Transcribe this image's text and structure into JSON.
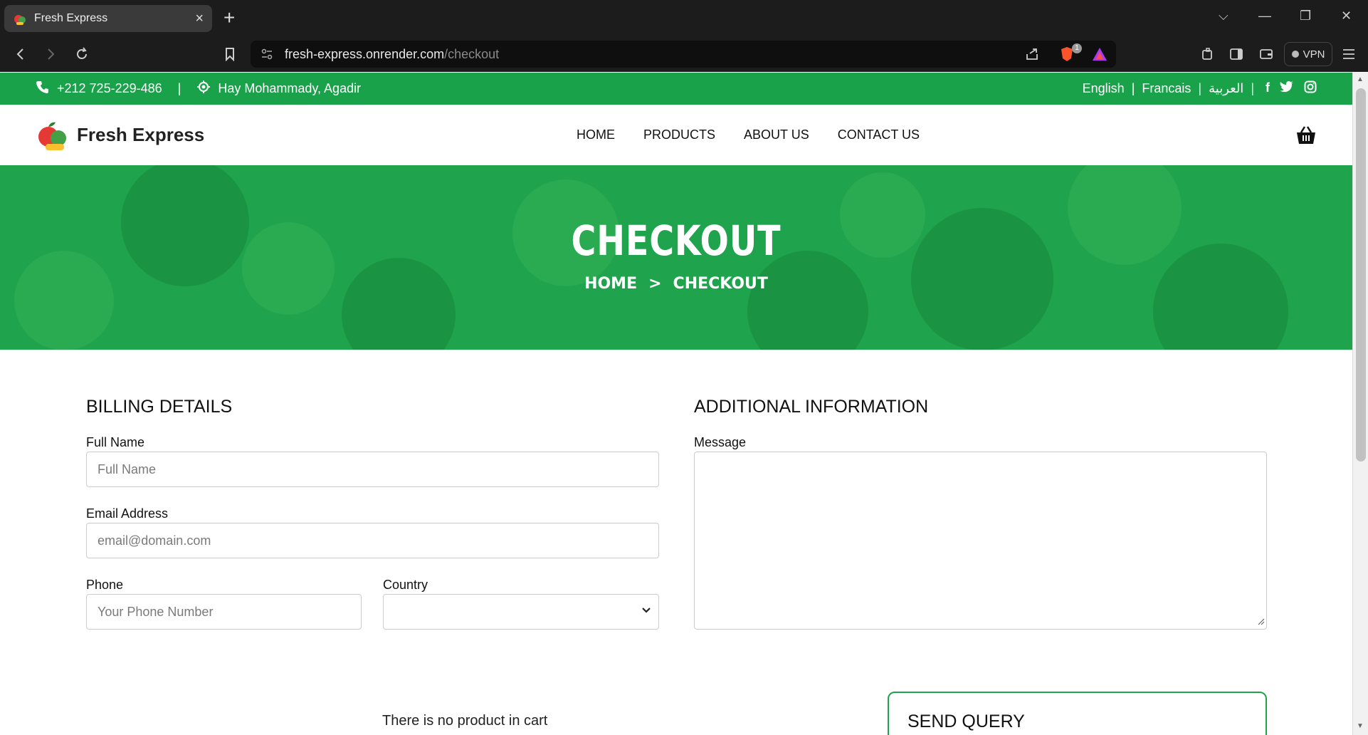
{
  "browser": {
    "tab_title": "Fresh Express",
    "url_host": "fresh-express.onrender.com",
    "url_path": "/checkout",
    "vpn_label": "VPN",
    "shield_count": "1"
  },
  "topbar": {
    "phone": "+212 725-229-486",
    "address": "Hay Mohammady, Agadir",
    "languages": [
      "English",
      "Francais",
      "العربية"
    ]
  },
  "nav": {
    "brand": "Fresh Express",
    "links": [
      "HOME",
      "PRODUCTS",
      "ABOUT US",
      "CONTACT US"
    ]
  },
  "hero": {
    "title": "CHECKOUT",
    "crumb_home": "HOME",
    "crumb_sep": ">",
    "crumb_current": "CHECKOUT"
  },
  "billing": {
    "heading": "BILLING DETAILS",
    "full_name_label": "Full Name",
    "full_name_placeholder": "Full Name",
    "email_label": "Email Address",
    "email_placeholder": "email@domain.com",
    "phone_label": "Phone",
    "phone_placeholder": "Your Phone Number",
    "country_label": "Country",
    "country_value": ""
  },
  "additional": {
    "heading": "ADDITIONAL INFORMATION",
    "message_label": "Message",
    "message_value": ""
  },
  "cart": {
    "empty_text": "There is no product in cart"
  },
  "query": {
    "heading": "SEND QUERY"
  },
  "colors": {
    "brand_green": "#1aa24a",
    "chrome_dark": "#1c1c1c"
  }
}
